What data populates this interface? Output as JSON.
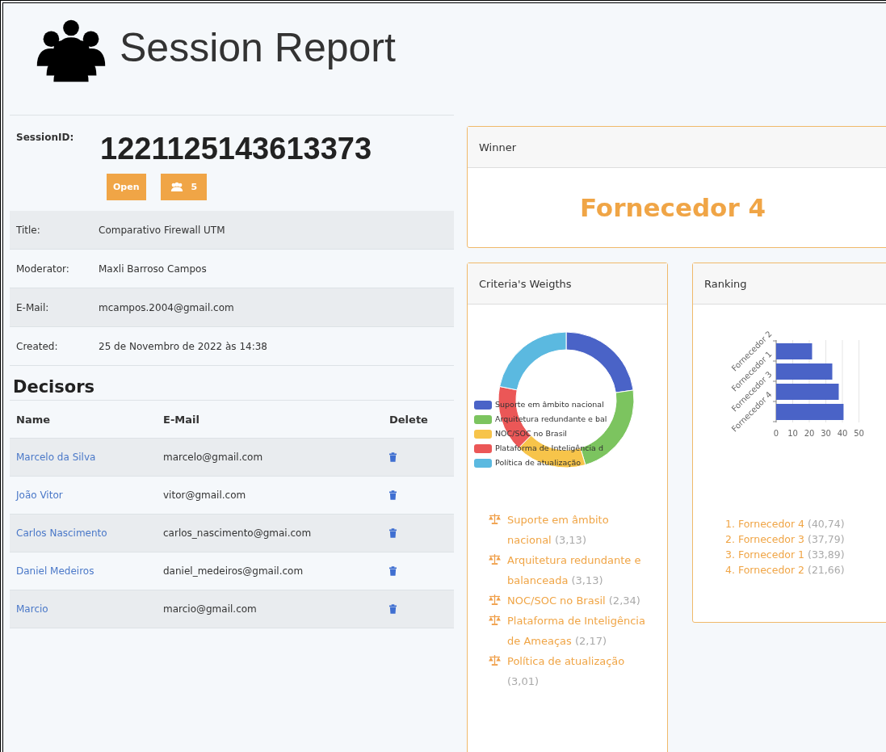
{
  "header": {
    "title": "Session Report"
  },
  "session": {
    "label": "SessionID:",
    "id": "1221125143613373",
    "status": "Open",
    "members": "5"
  },
  "info": [
    {
      "label": "Title:",
      "value": "Comparativo Firewall UTM"
    },
    {
      "label": "Moderator:",
      "value": "Maxli Barroso Campos"
    },
    {
      "label": "E-Mail:",
      "value": "mcampos.2004@gmail.com"
    },
    {
      "label": "Created:",
      "value": "25 de Novembro de 2022 às 14:38"
    }
  ],
  "decisors": {
    "heading": "Decisors",
    "columns": [
      "Name",
      "E-Mail",
      "Delete"
    ],
    "rows": [
      {
        "name": "Marcelo da Silva",
        "email": "marcelo@gmail.com"
      },
      {
        "name": "João Vitor",
        "email": "vitor@gmail.com"
      },
      {
        "name": "Carlos Nascimento",
        "email": "carlos_nascimento@gmai.com"
      },
      {
        "name": "Daniel Medeiros",
        "email": "daniel_medeiros@gmail.com"
      },
      {
        "name": "Marcio",
        "email": "marcio@gmail.com"
      }
    ]
  },
  "winner": {
    "title": "Winner",
    "name": "Fornecedor 4"
  },
  "criteria": {
    "title": "Criteria's Weigths",
    "chart_data": {
      "type": "donut",
      "categories": [
        "Suporte em âmbito nacional",
        "Arquitetura redundante e bal",
        "NOC/SOC no Brasil",
        "Plataforma de Inteligência d",
        "Política de atualização"
      ],
      "values": [
        22.71,
        22.71,
        16.98,
        15.75,
        21.85
      ],
      "colors": [
        "#4a63c7",
        "#7cc45f",
        "#f7c44a",
        "#eb5757",
        "#5bb9e0"
      ],
      "legend": true
    },
    "items": [
      {
        "name": "Suporte em âmbito nacional",
        "value": "(3,13)"
      },
      {
        "name": "Arquitetura redundante e balanceada",
        "value": "(3,13)"
      },
      {
        "name": "NOC/SOC no Brasil",
        "value": "(2,34)"
      },
      {
        "name": "Plataforma de Inteligência de Ameaças",
        "value": "(2,17)"
      },
      {
        "name": "Política de atualização",
        "value": "(3,01)"
      }
    ]
  },
  "ranking": {
    "title": "Ranking",
    "chart_data": {
      "type": "bar",
      "orientation": "horizontal",
      "categories": [
        "Fornecedor 2",
        "Fornecedor 1",
        "Fornecedor 3",
        "Fornecedor 4"
      ],
      "values": [
        21.7,
        33.9,
        37.8,
        40.7
      ],
      "color": "#4a63c7",
      "xlim": [
        0,
        50
      ],
      "xticks": [
        0,
        10,
        20,
        30,
        40,
        50
      ],
      "grid": true
    },
    "items": [
      {
        "rank": "1.",
        "name": "Fornecedor 4",
        "value": "(40,74)"
      },
      {
        "rank": "2.",
        "name": "Fornecedor 3",
        "value": "(37,79)"
      },
      {
        "rank": "3.",
        "name": "Fornecedor 1",
        "value": "(33,89)"
      },
      {
        "rank": "4.",
        "name": "Fornecedor 2",
        "value": "(21,66)"
      }
    ]
  }
}
